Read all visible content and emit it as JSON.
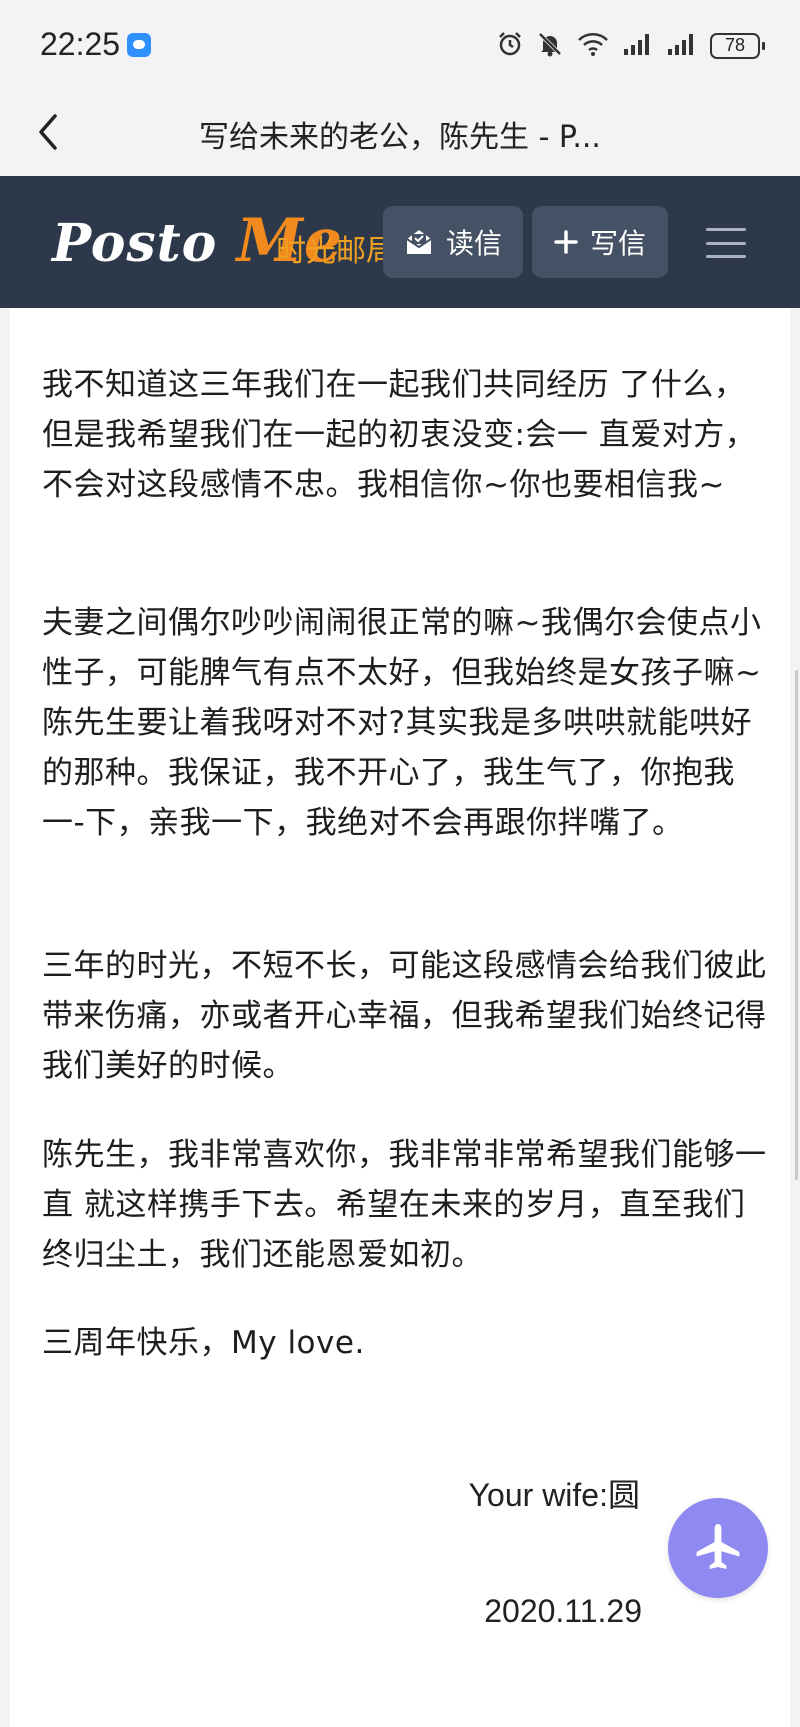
{
  "status_bar": {
    "time": "22:25",
    "battery": "78",
    "icons": [
      "message-app-icon",
      "alarm-icon",
      "mute-icon",
      "wifi-icon",
      "signal-icon",
      "signal-icon",
      "battery-icon"
    ]
  },
  "title_bar": {
    "title": "写给未来的老公，陈先生 - P...",
    "back_icon": "chevron-left-icon"
  },
  "site_header": {
    "logo_main": "Posto ",
    "logo_accent": "Me",
    "logo_tagline": "时光邮局",
    "read_label": "读信",
    "write_label": "写信",
    "colors": {
      "background": "#2d394a",
      "button": "#455164",
      "logo_accent": "#f28a1e",
      "tagline": "#f0a020"
    }
  },
  "letter": {
    "paragraphs": [
      "我不知道这三年我们在一起我们共同经历 了什么，但是我希望我们在一起的初衷没变:会一 直爱对方，不会对这段感情不忠。我相信你~你也要相信我~",
      "夫妻之间偶尔吵吵闹闹很正常的嘛~我偶尔会使点小性子，可能脾气有点不太好，但我始终是女孩子嘛~陈先生要让着我呀对不对?其实我是多哄哄就能哄好的那种。我保证，我不开心了，我生气了，你抱我一-下，亲我一下，我绝对不会再跟你拌嘴了。",
      "三年的时光，不短不长，可能这段感情会给我们彼此带来伤痛，亦或者开心幸福，但我希望我们始终记得我们美好的时候。",
      "陈先生，我非常喜欢你，我非常非常希望我们能够一直 就这样携手下去。希望在未来的岁月，直至我们终归尘土，我们还能恩爱如初。",
      "三周年快乐，My love."
    ],
    "signature": "Your wife:圆",
    "date": "2020.11.29"
  },
  "fab": {
    "icon": "airplane-icon",
    "color": "#8f89f2"
  }
}
